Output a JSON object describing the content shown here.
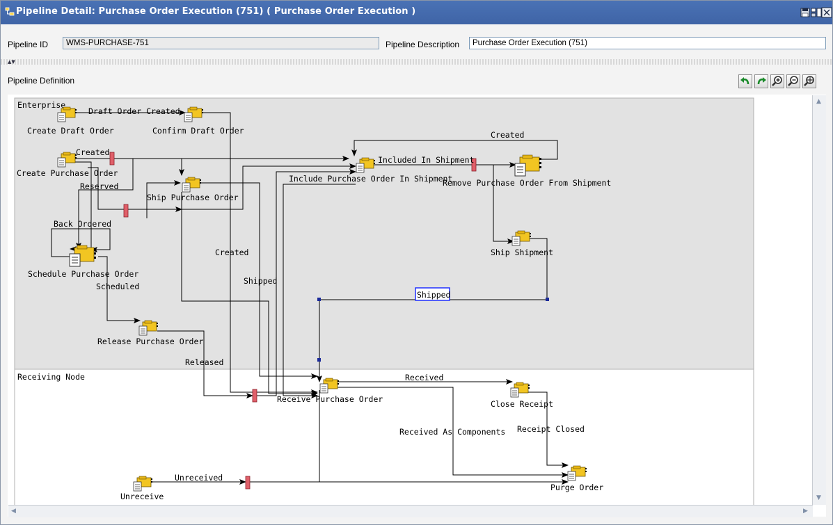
{
  "window": {
    "title": "Pipeline Detail: Purchase Order Execution (751) ( Purchase Order Execution )"
  },
  "fields": {
    "pipeline_id_label": "Pipeline ID",
    "pipeline_id_value": "WMS-PURCHASE-751",
    "pipeline_description_label": "Pipeline Description",
    "pipeline_description_value": "Purchase Order Execution (751)"
  },
  "definition": {
    "label": "Pipeline Definition"
  },
  "toolbar_icons": [
    "save-icon",
    "details-icon",
    "close-icon",
    "undo-icon",
    "redo-icon",
    "zoom-in-icon",
    "zoom-out-icon",
    "zoom-fit-icon"
  ],
  "diagram": {
    "lanes": [
      "Enterprise",
      "Receiving Node"
    ],
    "nodes": {
      "create_draft_order": "Create Draft Order",
      "confirm_draft_order": "Confirm Draft Order",
      "create_purchase_order": "Create Purchase Order",
      "ship_purchase_order": "Ship Purchase Order",
      "include_po_in_shipment": "Include Purchase Order In Shipment",
      "remove_po_from_shipment": "Remove Purchase Order From Shipment",
      "schedule_purchase_order": "Schedule Purchase Order",
      "ship_shipment": "Ship Shipment",
      "release_purchase_order": "Release Purchase Order",
      "receive_purchase_order": "Receive Purchase Order",
      "close_receipt": "Close Receipt",
      "purge_order": "Purge Order",
      "unreceive": "Unreceive"
    },
    "edges": {
      "draft_order_created": "Draft Order Created",
      "created_1": "Created",
      "created_2": "Created",
      "created_3": "Created",
      "included_in_shipment": "Included In Shipment",
      "reserved": "Reserved",
      "back_ordered": "Back Ordered",
      "shipped_1": "Shipped",
      "shipped_2": "Shipped",
      "scheduled": "Scheduled",
      "released": "Released",
      "received": "Received",
      "received_as_components": "Received As Components",
      "receipt_closed": "Receipt Closed",
      "unreceived": "Unreceived"
    }
  },
  "colors": {
    "titlebar": "#4a72b5",
    "lane_enterprise": "#e2e2e2",
    "lane_receiving": "#ffffff",
    "condition_marker": "#e0606a",
    "selected_label_border": "#2030ff"
  }
}
